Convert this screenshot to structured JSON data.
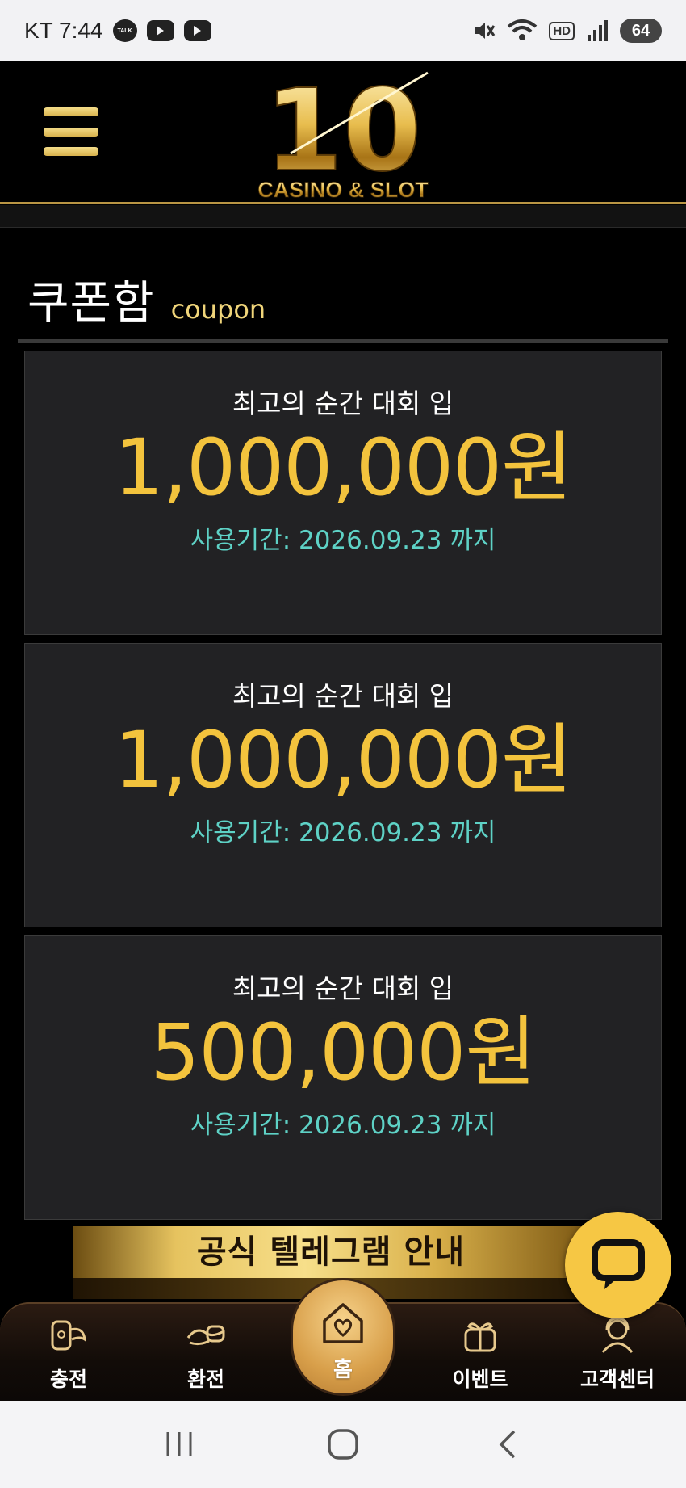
{
  "status_bar": {
    "carrier_time": "KT 7:44",
    "talk_badge": "TALK",
    "hd_label": "HD",
    "battery": "64"
  },
  "header": {
    "logo_number": "10",
    "logo_text": "CASINO & SLOT"
  },
  "page": {
    "title_ko": "쿠폰함",
    "title_en": "coupon"
  },
  "coupons": [
    {
      "name": "최고의 순간 대회 입",
      "amount": "1,000,000원",
      "period": "사용기간: 2026.09.23 까지"
    },
    {
      "name": "최고의 순간 대회 입",
      "amount": "1,000,000원",
      "period": "사용기간: 2026.09.23 까지"
    },
    {
      "name": "최고의 순간 대회 입",
      "amount": "500,000원",
      "period": "사용기간: 2026.09.23 까지"
    }
  ],
  "banner": {
    "text": "공식 텔레그램 안내"
  },
  "bottom_nav": {
    "charge": "충전",
    "exchange": "환전",
    "home": "홈",
    "event": "이벤트",
    "support": "고객센터"
  },
  "colors": {
    "gold": "#f3c33d",
    "teal": "#5ed2c6",
    "card_bg": "#222224"
  }
}
